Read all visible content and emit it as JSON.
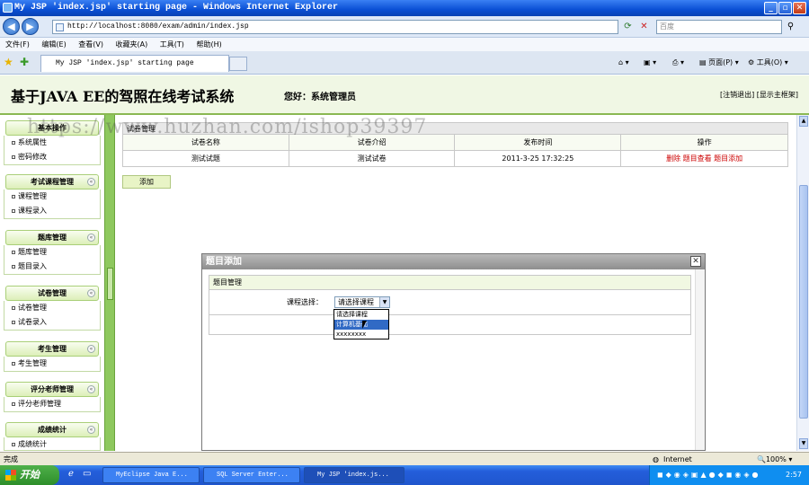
{
  "window": {
    "title": "My JSP 'index.jsp' starting page - Windows Internet Explorer",
    "min": "_",
    "max": "▫",
    "close": "✕"
  },
  "address": {
    "url": "http://localhost:8080/exam/admin/index.jsp",
    "search_placeholder": "百度"
  },
  "menu": [
    "文件(F)",
    "编辑(E)",
    "查看(V)",
    "收藏夹(A)",
    "工具(T)",
    "帮助(H)"
  ],
  "tab": {
    "label": "My JSP 'index.jsp' starting page"
  },
  "toolbar_right": {
    "page": "页面(P)",
    "tools": "工具(O)"
  },
  "header": {
    "title": "基于JAVA EE的驾照在线考试系统",
    "greeting": "您好：系统管理员",
    "links": "[注销退出] [显示主框架]"
  },
  "sidebar": {
    "groups": [
      {
        "title": "基本操作",
        "items": [
          "系统属性",
          "密码修改"
        ]
      },
      {
        "title": "考试课程管理",
        "items": [
          "课程管理",
          "课程录入"
        ]
      },
      {
        "title": "题库管理",
        "items": [
          "题库管理",
          "题目录入"
        ]
      },
      {
        "title": "试卷管理",
        "items": [
          "试卷管理",
          "试卷录入"
        ]
      },
      {
        "title": "考生管理",
        "items": [
          "考生管理"
        ]
      },
      {
        "title": "评分老师管理",
        "items": [
          "评分老师管理"
        ]
      },
      {
        "title": "成绩统计",
        "items": [
          "成绩统计"
        ]
      }
    ]
  },
  "table": {
    "caption": "试卷管理",
    "headers": [
      "试卷名称",
      "试卷介绍",
      "发布时间",
      "操作"
    ],
    "rows": [
      {
        "name": "测试试题",
        "intro": "测试试卷",
        "time": "2011-3-25 17:32:25",
        "actions": "删除  题目查看  题目添加"
      }
    ],
    "add_button": "添加"
  },
  "modal": {
    "title": "题目添加",
    "close": "✕",
    "section": "题目管理",
    "course_label": "课程选择：",
    "course_selected": "请选择课程",
    "options": [
      "请选择课程",
      "计算机基础",
      "xxxxxxxx"
    ]
  },
  "watermark": "https://www.huzhan.com/ishop39397",
  "status": {
    "left": "完成",
    "zone": "Internet",
    "zoom": "100%"
  },
  "taskbar": {
    "start": "开始",
    "tasks": [
      "MyEclipse Java E...",
      "SQL Server Enter...",
      "My JSP 'index.js..."
    ],
    "clock": "2:57"
  }
}
